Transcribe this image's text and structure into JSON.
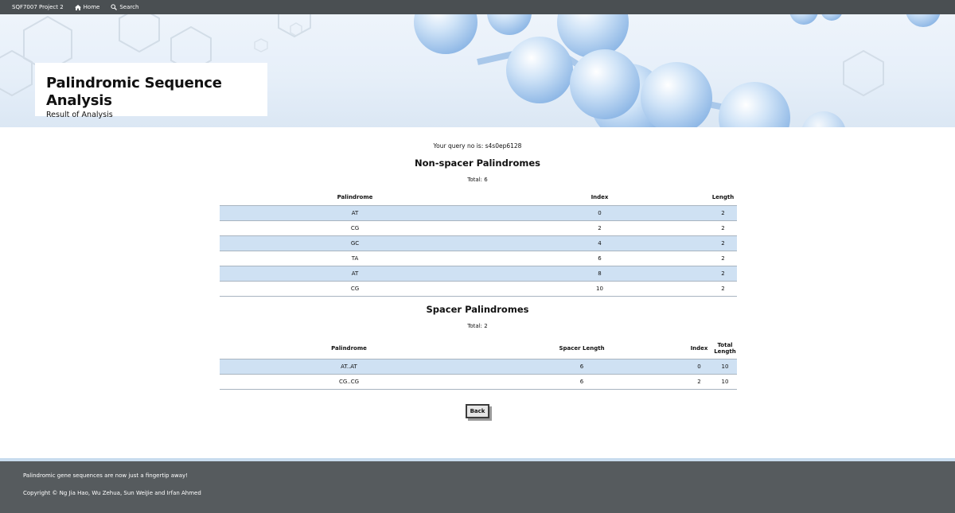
{
  "nav": {
    "brand": "SQF7007 Project 2",
    "home_label": "Home",
    "search_label": "Search"
  },
  "header": {
    "title": "Palindromic Sequence Analysis",
    "subtitle": "Result of Analysis"
  },
  "query": {
    "text": "Your query no is: s4s0ep6128"
  },
  "non_spacer": {
    "heading": "Non-spacer Palindromes",
    "total": "Total: 6",
    "columns": [
      "Palindrome",
      "Index",
      "Length"
    ],
    "rows": [
      [
        "AT",
        "0",
        "2"
      ],
      [
        "CG",
        "2",
        "2"
      ],
      [
        "GC",
        "4",
        "2"
      ],
      [
        "TA",
        "6",
        "2"
      ],
      [
        "AT",
        "8",
        "2"
      ],
      [
        "CG",
        "10",
        "2"
      ]
    ]
  },
  "spacer": {
    "heading": "Spacer Palindromes",
    "total": "Total: 2",
    "columns": [
      "Palindrome",
      "Spacer Length",
      "Index",
      "Total Length"
    ],
    "rows": [
      [
        "AT..AT",
        "6",
        "0",
        "10"
      ],
      [
        "CG..CG",
        "6",
        "2",
        "10"
      ]
    ]
  },
  "back_label": "Back",
  "footer": {
    "tagline": "Palindromic gene sequences are now just a fingertip away!",
    "copyright": "Copyright © Ng Jia Hao, Wu Zehua, Sun WeiJie and Irfan Ahmed"
  },
  "colors": {
    "navbar": "#4a4f52",
    "footer": "#565b5e",
    "row_shade": "#cfe1f3",
    "banner": "#e6eff9"
  },
  "icons": {
    "home": "home-icon",
    "search": "search-icon"
  }
}
